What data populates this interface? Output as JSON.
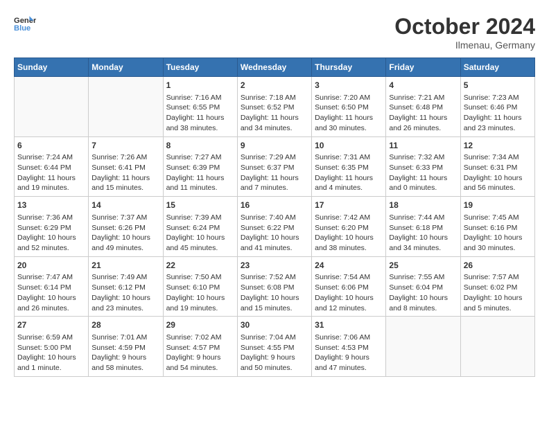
{
  "header": {
    "logo_line1": "General",
    "logo_line2": "Blue",
    "month": "October 2024",
    "location": "Ilmenau, Germany"
  },
  "weekdays": [
    "Sunday",
    "Monday",
    "Tuesday",
    "Wednesday",
    "Thursday",
    "Friday",
    "Saturday"
  ],
  "weeks": [
    [
      {
        "day": "",
        "content": ""
      },
      {
        "day": "",
        "content": ""
      },
      {
        "day": "1",
        "content": "Sunrise: 7:16 AM\nSunset: 6:55 PM\nDaylight: 11 hours and 38 minutes."
      },
      {
        "day": "2",
        "content": "Sunrise: 7:18 AM\nSunset: 6:52 PM\nDaylight: 11 hours and 34 minutes."
      },
      {
        "day": "3",
        "content": "Sunrise: 7:20 AM\nSunset: 6:50 PM\nDaylight: 11 hours and 30 minutes."
      },
      {
        "day": "4",
        "content": "Sunrise: 7:21 AM\nSunset: 6:48 PM\nDaylight: 11 hours and 26 minutes."
      },
      {
        "day": "5",
        "content": "Sunrise: 7:23 AM\nSunset: 6:46 PM\nDaylight: 11 hours and 23 minutes."
      }
    ],
    [
      {
        "day": "6",
        "content": "Sunrise: 7:24 AM\nSunset: 6:44 PM\nDaylight: 11 hours and 19 minutes."
      },
      {
        "day": "7",
        "content": "Sunrise: 7:26 AM\nSunset: 6:41 PM\nDaylight: 11 hours and 15 minutes."
      },
      {
        "day": "8",
        "content": "Sunrise: 7:27 AM\nSunset: 6:39 PM\nDaylight: 11 hours and 11 minutes."
      },
      {
        "day": "9",
        "content": "Sunrise: 7:29 AM\nSunset: 6:37 PM\nDaylight: 11 hours and 7 minutes."
      },
      {
        "day": "10",
        "content": "Sunrise: 7:31 AM\nSunset: 6:35 PM\nDaylight: 11 hours and 4 minutes."
      },
      {
        "day": "11",
        "content": "Sunrise: 7:32 AM\nSunset: 6:33 PM\nDaylight: 11 hours and 0 minutes."
      },
      {
        "day": "12",
        "content": "Sunrise: 7:34 AM\nSunset: 6:31 PM\nDaylight: 10 hours and 56 minutes."
      }
    ],
    [
      {
        "day": "13",
        "content": "Sunrise: 7:36 AM\nSunset: 6:29 PM\nDaylight: 10 hours and 52 minutes."
      },
      {
        "day": "14",
        "content": "Sunrise: 7:37 AM\nSunset: 6:26 PM\nDaylight: 10 hours and 49 minutes."
      },
      {
        "day": "15",
        "content": "Sunrise: 7:39 AM\nSunset: 6:24 PM\nDaylight: 10 hours and 45 minutes."
      },
      {
        "day": "16",
        "content": "Sunrise: 7:40 AM\nSunset: 6:22 PM\nDaylight: 10 hours and 41 minutes."
      },
      {
        "day": "17",
        "content": "Sunrise: 7:42 AM\nSunset: 6:20 PM\nDaylight: 10 hours and 38 minutes."
      },
      {
        "day": "18",
        "content": "Sunrise: 7:44 AM\nSunset: 6:18 PM\nDaylight: 10 hours and 34 minutes."
      },
      {
        "day": "19",
        "content": "Sunrise: 7:45 AM\nSunset: 6:16 PM\nDaylight: 10 hours and 30 minutes."
      }
    ],
    [
      {
        "day": "20",
        "content": "Sunrise: 7:47 AM\nSunset: 6:14 PM\nDaylight: 10 hours and 26 minutes."
      },
      {
        "day": "21",
        "content": "Sunrise: 7:49 AM\nSunset: 6:12 PM\nDaylight: 10 hours and 23 minutes."
      },
      {
        "day": "22",
        "content": "Sunrise: 7:50 AM\nSunset: 6:10 PM\nDaylight: 10 hours and 19 minutes."
      },
      {
        "day": "23",
        "content": "Sunrise: 7:52 AM\nSunset: 6:08 PM\nDaylight: 10 hours and 15 minutes."
      },
      {
        "day": "24",
        "content": "Sunrise: 7:54 AM\nSunset: 6:06 PM\nDaylight: 10 hours and 12 minutes."
      },
      {
        "day": "25",
        "content": "Sunrise: 7:55 AM\nSunset: 6:04 PM\nDaylight: 10 hours and 8 minutes."
      },
      {
        "day": "26",
        "content": "Sunrise: 7:57 AM\nSunset: 6:02 PM\nDaylight: 10 hours and 5 minutes."
      }
    ],
    [
      {
        "day": "27",
        "content": "Sunrise: 6:59 AM\nSunset: 5:00 PM\nDaylight: 10 hours and 1 minute."
      },
      {
        "day": "28",
        "content": "Sunrise: 7:01 AM\nSunset: 4:59 PM\nDaylight: 9 hours and 58 minutes."
      },
      {
        "day": "29",
        "content": "Sunrise: 7:02 AM\nSunset: 4:57 PM\nDaylight: 9 hours and 54 minutes."
      },
      {
        "day": "30",
        "content": "Sunrise: 7:04 AM\nSunset: 4:55 PM\nDaylight: 9 hours and 50 minutes."
      },
      {
        "day": "31",
        "content": "Sunrise: 7:06 AM\nSunset: 4:53 PM\nDaylight: 9 hours and 47 minutes."
      },
      {
        "day": "",
        "content": ""
      },
      {
        "day": "",
        "content": ""
      }
    ]
  ]
}
